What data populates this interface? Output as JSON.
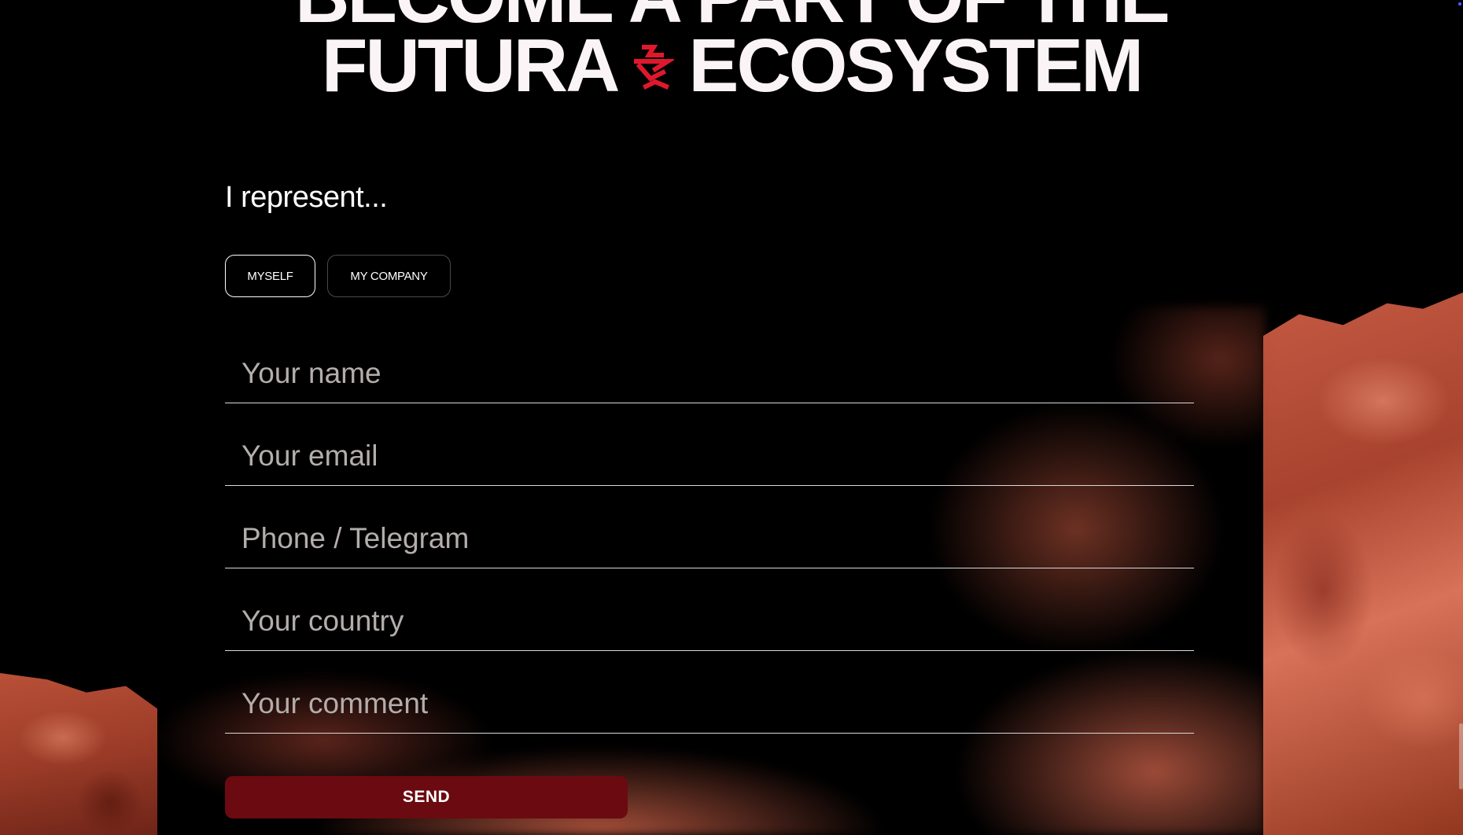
{
  "heading": {
    "line1": "BECOME A PART OF THE",
    "line2_left": "FUTURA",
    "line2_right": "ECOSYSTEM",
    "accent_color": "#e0182d"
  },
  "form": {
    "represent_label": "I represent...",
    "options": [
      {
        "label": "MYSELF",
        "selected": true
      },
      {
        "label": "MY COMPANY",
        "selected": false
      }
    ],
    "fields": {
      "name_placeholder": "Your name",
      "email_placeholder": "Your email",
      "phone_placeholder": "Phone / Telegram",
      "country_placeholder": "Your country",
      "comment_placeholder": "Your comment"
    },
    "send_label": "SEND",
    "send_color": "#6b0a10"
  },
  "icons": {
    "logo": "futura-logo-icon"
  }
}
